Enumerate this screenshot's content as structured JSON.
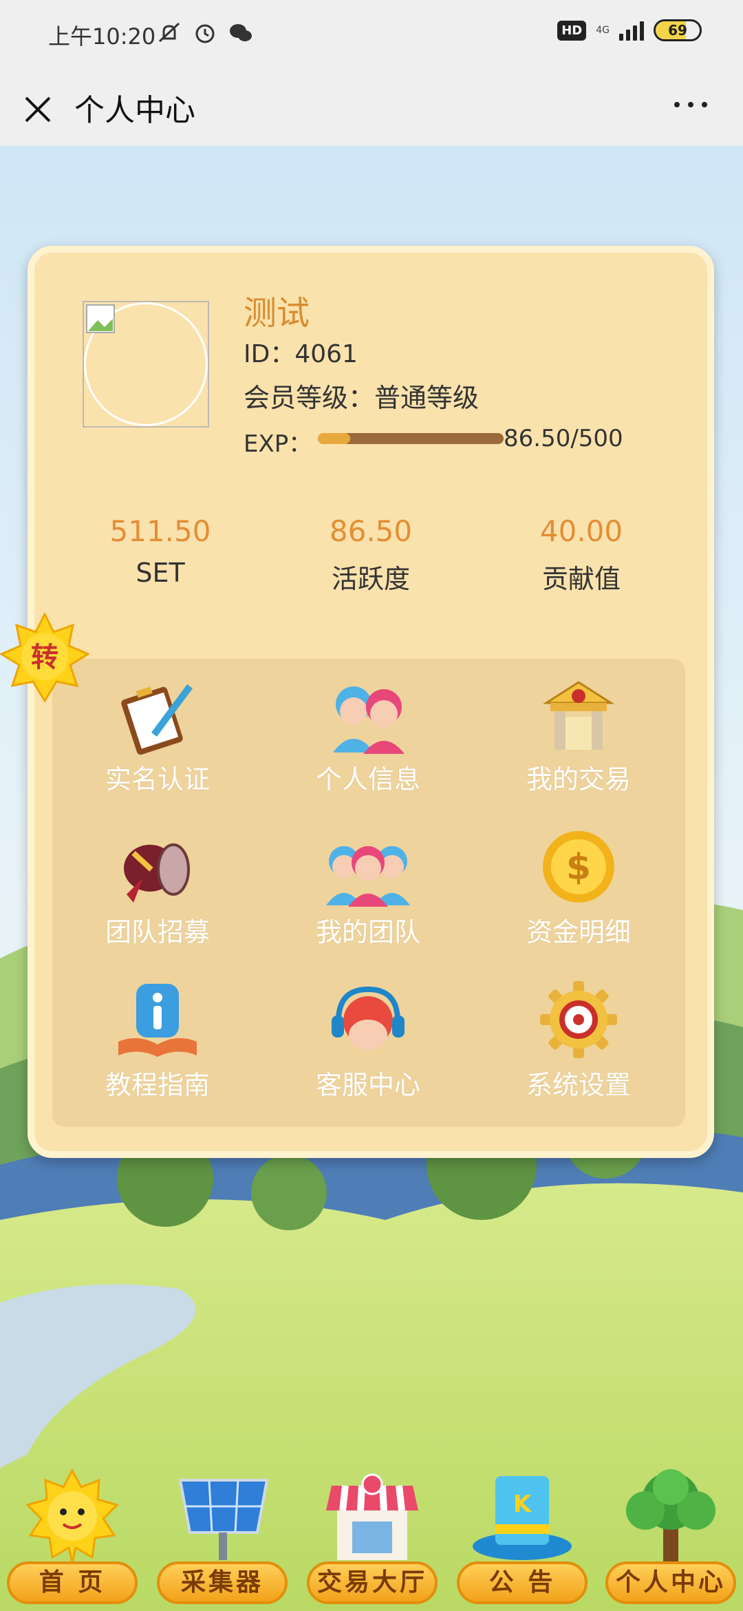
{
  "status_bar": {
    "time": "上午10:20",
    "hd": "HD",
    "network": "4G",
    "battery": "69"
  },
  "nav": {
    "title": "个人中心"
  },
  "profile": {
    "username": "测试",
    "id_text": "ID：4061",
    "level_text": "会员等级：普通等级",
    "exp_label": "EXP：",
    "exp_value": "86.50/500",
    "exp_progress": 0.173
  },
  "stats": [
    {
      "value": "511.50",
      "label": "SET"
    },
    {
      "value": "86.50",
      "label": "活跃度"
    },
    {
      "value": "40.00",
      "label": "贡献值"
    }
  ],
  "badge": {
    "text": "转"
  },
  "menu": [
    {
      "label": "实名认证",
      "icon": "clipboard-pen-icon"
    },
    {
      "label": "个人信息",
      "icon": "couple-avatar-icon"
    },
    {
      "label": "我的交易",
      "icon": "gold-gate-icon"
    },
    {
      "label": "团队招募",
      "icon": "horn-scroll-icon"
    },
    {
      "label": "我的团队",
      "icon": "team-avatars-icon"
    },
    {
      "label": "资金明细",
      "icon": "gold-coin-icon"
    },
    {
      "label": "教程指南",
      "icon": "info-book-icon"
    },
    {
      "label": "客服中心",
      "icon": "headset-agent-icon"
    },
    {
      "label": "系统设置",
      "icon": "gear-icon"
    }
  ],
  "tabs": [
    {
      "label": "首 页",
      "icon": "sun-icon"
    },
    {
      "label": "采集器",
      "icon": "solar-panel-icon"
    },
    {
      "label": "交易大厅",
      "icon": "shop-icon"
    },
    {
      "label": "公 告",
      "icon": "magic-hat-icon"
    },
    {
      "label": "个人中心",
      "icon": "tree-icon"
    }
  ],
  "colors": {
    "card_bg": "#fae2ad",
    "accent": "#e38e34",
    "tab_label": "#f2a21a"
  }
}
